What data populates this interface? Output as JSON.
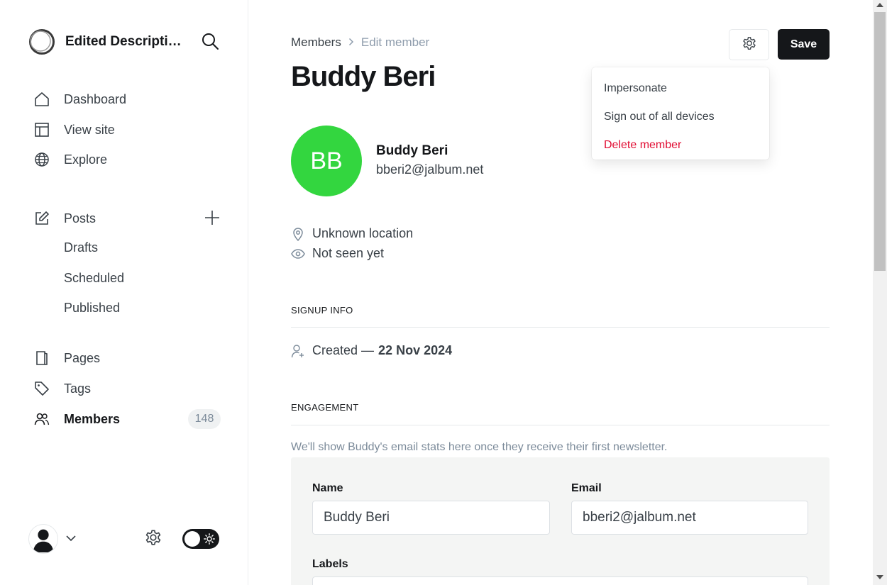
{
  "sidebar": {
    "brand_title": "Edited Description for Site",
    "nav": {
      "dashboard": "Dashboard",
      "view_site": "View site",
      "explore": "Explore",
      "posts": "Posts",
      "drafts": "Drafts",
      "scheduled": "Scheduled",
      "published": "Published",
      "pages": "Pages",
      "tags": "Tags",
      "members": "Members",
      "members_count": "148"
    }
  },
  "header": {
    "breadcrumb_parent": "Members",
    "breadcrumb_sep": ">",
    "breadcrumb_current": "Edit member",
    "title": "Buddy Beri",
    "save_label": "Save"
  },
  "dropdown": {
    "items": [
      "Impersonate",
      "Sign out of all devices",
      "Delete member"
    ]
  },
  "member": {
    "initials": "BB",
    "name": "Buddy Beri",
    "email": "bberi2@jalbum.net",
    "avatar_color": "#33d63f",
    "location": "Unknown location",
    "last_seen": "Not seen yet"
  },
  "signup": {
    "section_title": "SIGNUP INFO",
    "created_prefix": "Created —",
    "created_date": "22 Nov 2024"
  },
  "engagement": {
    "section_title": "ENGAGEMENT",
    "note": "We'll show Buddy's email stats here once they receive their first newsletter."
  },
  "form": {
    "name_label": "Name",
    "name_value": "Buddy Beri",
    "email_label": "Email",
    "email_value": "bberi2@jalbum.net",
    "labels_label": "Labels"
  },
  "colors": {
    "accent": "#15171a",
    "danger": "#e10d33",
    "avatar": "#33d63f"
  }
}
